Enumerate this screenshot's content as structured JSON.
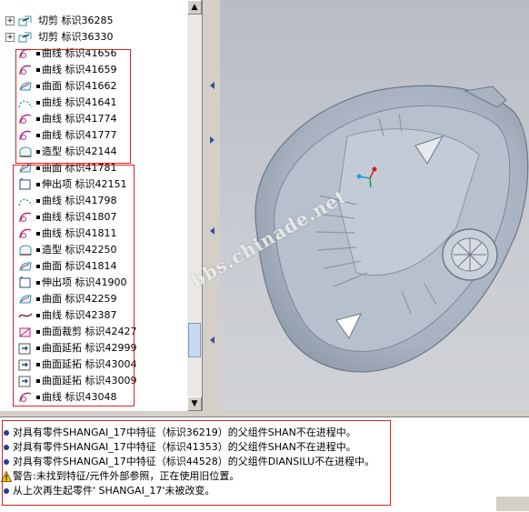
{
  "tree": {
    "items": [
      {
        "label": "切剪 标识36285",
        "icon": "cut-feature-icon",
        "expand": "+"
      },
      {
        "label": "切剪 标识36330",
        "icon": "cut-feature-icon",
        "expand": "+"
      },
      {
        "label": "曲线 标识41656",
        "icon": "curve-icon"
      },
      {
        "label": "曲线 标识41659",
        "icon": "curve-icon"
      },
      {
        "label": "曲面 标识41662",
        "icon": "surface-icon"
      },
      {
        "label": "曲线 标识41641",
        "icon": "dashed-curve-icon"
      },
      {
        "label": "曲线 标识41774",
        "icon": "curve-icon"
      },
      {
        "label": "曲线 标识41777",
        "icon": "curve-icon"
      },
      {
        "label": "造型 标识42144",
        "icon": "style-icon"
      },
      {
        "label": "曲面 标识41781",
        "icon": "surface-icon"
      },
      {
        "label": "伸出项 标识42151",
        "icon": "protrusion-icon"
      },
      {
        "label": "曲线 标识41798",
        "icon": "dashed-curve-icon"
      },
      {
        "label": "曲线 标识41807",
        "icon": "curve-icon"
      },
      {
        "label": "曲线 标识41811",
        "icon": "curve-icon"
      },
      {
        "label": "造型 标识42250",
        "icon": "style-icon"
      },
      {
        "label": "曲面 标识41814",
        "icon": "surface-icon"
      },
      {
        "label": "伸出项 标识41900",
        "icon": "protrusion-icon"
      },
      {
        "label": "曲面 标识42259",
        "icon": "surface-icon"
      },
      {
        "label": "曲线 标识42387",
        "icon": "wave-curve-icon"
      },
      {
        "label": "曲面裁剪 标识42427",
        "icon": "trim-icon"
      },
      {
        "label": "曲面延拓 标识42999",
        "icon": "extend-icon"
      },
      {
        "label": "曲面延拓 标识43004",
        "icon": "extend-icon"
      },
      {
        "label": "曲面延拓 标识43009",
        "icon": "extend-icon"
      },
      {
        "label": "曲线 标识43048",
        "icon": "curve-icon"
      }
    ]
  },
  "messages": [
    {
      "type": "info",
      "text": "对具有零件SHANGAI_17中特征（标识36219）的父组件SHAN不在进程中。"
    },
    {
      "type": "info",
      "text": "对具有零件SHANGAI_17中特征（标识41353）的父组件SHAN不在进程中。"
    },
    {
      "type": "info",
      "text": "对具有零件SHANGAI_17中特征（标识44528）的父组件DIANSILU不在进程中。"
    },
    {
      "type": "warning",
      "text": "警告:未找到特征/元件外部参照，正在使用旧位置。"
    },
    {
      "type": "info",
      "text": "从上次再生起零件' SHANGAI_17'未被改变。"
    }
  ],
  "watermark": "bbs.chinade.net",
  "scrollbar": {
    "up": "▲",
    "down": "▼"
  },
  "colors": {
    "highlight": "#dd2222",
    "icon_magenta": "#b0307a",
    "icon_cyan": "#2a9aa8",
    "model": "#9aa6b6"
  }
}
